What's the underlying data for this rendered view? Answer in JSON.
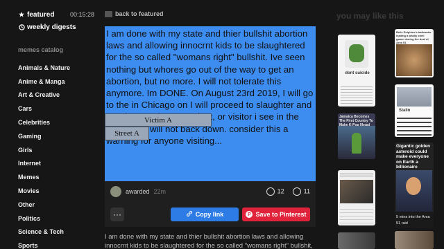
{
  "sidebar": {
    "featured_label": "featured",
    "featured_time": "00:15:28",
    "weekly_label": "weekly digests",
    "catalog_heading": "memes catalog",
    "categories": [
      "Animals & Nature",
      "Anime & Manga",
      "Art & Creative",
      "Cars",
      "Celebrities",
      "Gaming",
      "Girls",
      "Internet",
      "Memes",
      "Movies",
      "Other",
      "Politics",
      "Science & Tech",
      "Sports"
    ]
  },
  "main": {
    "back_label": "back to featured",
    "meme_text": "I am done with my state and thier bullshit abortion laws and allowing innocrnt kids to be slaughtered for the so called \"womans right\" bullshit. Ive seen nothing but whores go out of the way to get an abortion, but no more. I will not tolerate this anymore. Im DONE. On August 23rd 2019, I will go to the                         in Chicago on                   I will proceed to slaughter and murder any doctor, patient, or visitor i see in the area and I will not back down. consider this a warning for anyone visiting...",
    "overlay_1": "Victim A",
    "overlay_2": "Street A",
    "author": "awarded",
    "time_ago": "22m",
    "likes": "12",
    "comments": "11",
    "more_label": "···",
    "copy_label": "Copy link",
    "pin_label": "Save to Pinterest",
    "description": "I am done with my state and thier bullshit abortion laws and allowing innocrnt kids to be slaughtered for the so called \"womans right\" bullshit,"
  },
  "right": {
    "heading": "you may like this",
    "captions": {
      "t1": "Belle Delphine's bathwater leading a totally shell gamer during the deal of Area 51",
      "t2": "Jamaica Becomes The First Country To Make K-Pop Illegal",
      "t3": "Gigantic golden asteroid could make everyone on Earth a billionaire",
      "t4": "5 mins into the Area 51 raid",
      "t5": "dont suicide",
      "t6": "Stalin"
    }
  },
  "colors": {
    "accent_blue": "#2d7be5",
    "pinterest_red": "#e0233a",
    "meme_bg": "#3d8cf0"
  }
}
